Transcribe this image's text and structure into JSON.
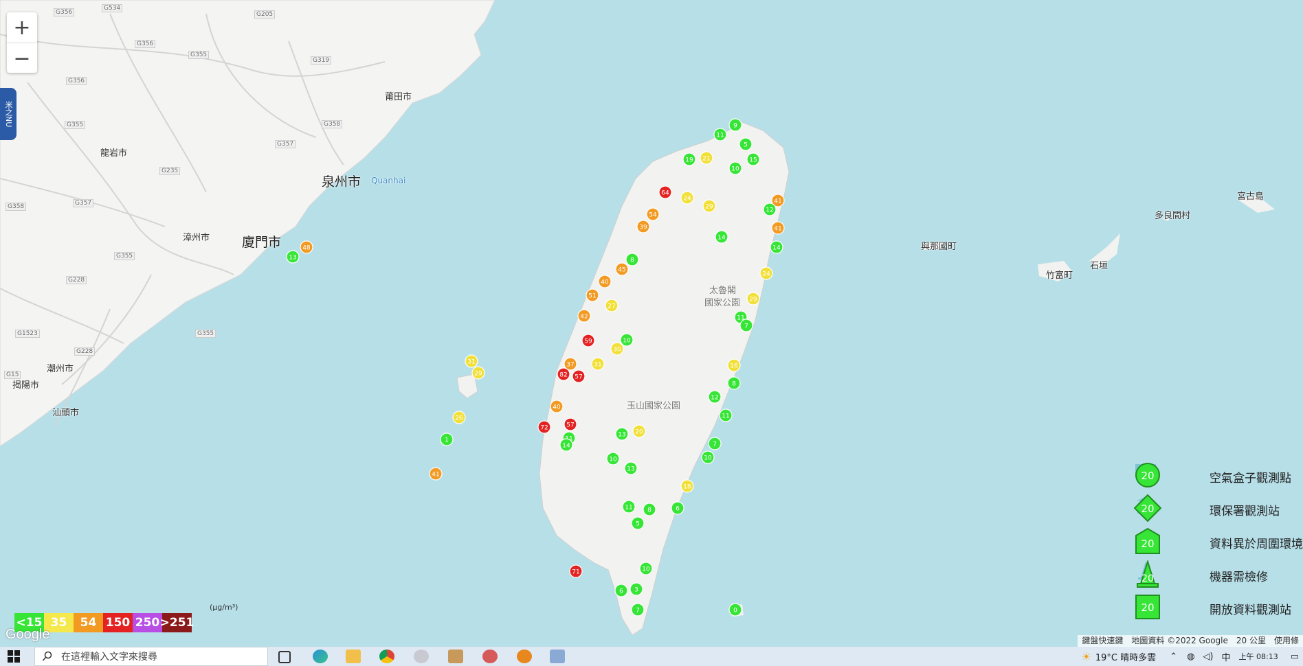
{
  "map": {
    "places": [
      {
        "name": "莆田市",
        "cls": ""
      },
      {
        "name": "龍岩市",
        "cls": ""
      },
      {
        "name": "泉州市",
        "cls": "big"
      },
      {
        "name": "漳州市",
        "cls": ""
      },
      {
        "name": "廈門市",
        "cls": "big"
      },
      {
        "name": "潮州市",
        "cls": ""
      },
      {
        "name": "揭陽市",
        "cls": ""
      },
      {
        "name": "汕頭市",
        "cls": ""
      },
      {
        "name": "Quanhai",
        "cls": "sea"
      },
      {
        "name": "與那國町",
        "cls": ""
      },
      {
        "name": "竹富町",
        "cls": ""
      },
      {
        "name": "石垣",
        "cls": ""
      },
      {
        "name": "多良間村",
        "cls": ""
      },
      {
        "name": "宮古島",
        "cls": ""
      },
      {
        "name": "太魯閣",
        "cls": "park"
      },
      {
        "name": "國家公園",
        "cls": "park"
      },
      {
        "name": "玉山國家公園",
        "cls": "park"
      }
    ],
    "roads": [
      "G356",
      "G534",
      "G205",
      "G356",
      "G355",
      "G319",
      "G356",
      "G355",
      "G358",
      "G357",
      "G235",
      "G358",
      "G357",
      "G355",
      "G228",
      "G355",
      "G1523",
      "G228",
      "G15"
    ],
    "zoom_in": "+",
    "zoom_out": "−",
    "side_tab": "米之NU"
  },
  "stations": [
    {
      "v": 9,
      "s": "box",
      "c": "#36e536"
    },
    {
      "v": 11,
      "s": "box",
      "c": "#36e536"
    },
    {
      "v": 5,
      "s": "box",
      "c": "#36e536"
    },
    {
      "v": 19,
      "s": "box",
      "c": "#36e536"
    },
    {
      "v": 21,
      "s": "box",
      "c": "#f2e03a"
    },
    {
      "v": 15,
      "s": "box",
      "c": "#36e536"
    },
    {
      "v": 10,
      "s": "box",
      "c": "#36e536"
    },
    {
      "v": 64,
      "s": "box",
      "c": "#e52222"
    },
    {
      "v": 24,
      "s": "box",
      "c": "#f2e03a"
    },
    {
      "v": 29,
      "s": "box",
      "c": "#f2e03a"
    },
    {
      "v": 41,
      "s": "box",
      "c": "#f29a22"
    },
    {
      "v": 12,
      "s": "box",
      "c": "#36e536"
    },
    {
      "v": 54,
      "s": "box",
      "c": "#f29a22"
    },
    {
      "v": 39,
      "s": "box",
      "c": "#f29a22"
    },
    {
      "v": 14,
      "s": "box",
      "c": "#36e536"
    },
    {
      "v": 8,
      "s": "box",
      "c": "#36e536"
    },
    {
      "v": 45,
      "s": "box",
      "c": "#f29a22"
    },
    {
      "v": 40,
      "s": "box",
      "c": "#f29a22"
    },
    {
      "v": 51,
      "s": "box",
      "c": "#f29a22"
    },
    {
      "v": 27,
      "s": "box",
      "c": "#f2e03a"
    },
    {
      "v": 42,
      "s": "box",
      "c": "#f29a22"
    },
    {
      "v": 59,
      "s": "box",
      "c": "#e52222"
    },
    {
      "v": 30,
      "s": "box",
      "c": "#f2e03a"
    },
    {
      "v": 10,
      "s": "box",
      "c": "#36e536"
    },
    {
      "v": 31,
      "s": "box",
      "c": "#f2e03a"
    },
    {
      "v": 37,
      "s": "box",
      "c": "#f29a22"
    },
    {
      "v": 82,
      "s": "box",
      "c": "#e52222"
    },
    {
      "v": 57,
      "s": "box",
      "c": "#e52222"
    },
    {
      "v": 40,
      "s": "box",
      "c": "#f29a22"
    },
    {
      "v": 72,
      "s": "box",
      "c": "#e52222"
    },
    {
      "v": 57,
      "s": "box",
      "c": "#e52222"
    },
    {
      "v": 11,
      "s": "box",
      "c": "#36e536"
    },
    {
      "v": 14,
      "s": "box",
      "c": "#36e536"
    },
    {
      "v": 13,
      "s": "box",
      "c": "#36e536"
    },
    {
      "v": 20,
      "s": "box",
      "c": "#f2e03a"
    },
    {
      "v": 10,
      "s": "box",
      "c": "#36e536"
    },
    {
      "v": 13,
      "s": "box",
      "c": "#36e536"
    },
    {
      "v": 11,
      "s": "box",
      "c": "#36e536"
    },
    {
      "v": 8,
      "s": "box",
      "c": "#36e536"
    },
    {
      "v": 5,
      "s": "box",
      "c": "#36e536"
    },
    {
      "v": 71,
      "s": "box",
      "c": "#e52222"
    },
    {
      "v": 10,
      "s": "box",
      "c": "#36e536"
    },
    {
      "v": 6,
      "s": "box",
      "c": "#36e536"
    },
    {
      "v": 3,
      "s": "box",
      "c": "#36e536"
    },
    {
      "v": 7,
      "s": "box",
      "c": "#36e536"
    },
    {
      "v": 0,
      "s": "box",
      "c": "#36e536"
    },
    {
      "v": 48,
      "s": "box",
      "c": "#f29a22"
    },
    {
      "v": 13,
      "s": "box",
      "c": "#36e536"
    },
    {
      "v": 31,
      "s": "box",
      "c": "#f2e03a"
    },
    {
      "v": 29,
      "s": "box",
      "c": "#f2e03a"
    },
    {
      "v": 26,
      "s": "box",
      "c": "#f2e03a"
    },
    {
      "v": 1,
      "s": "box",
      "c": "#36e536"
    },
    {
      "v": 41,
      "s": "box",
      "c": "#f29a22"
    },
    {
      "v": 11,
      "s": "box",
      "c": "#36e536"
    },
    {
      "v": 24,
      "s": "box",
      "c": "#f2e03a"
    },
    {
      "v": 14,
      "s": "box",
      "c": "#36e536"
    },
    {
      "v": 41,
      "s": "box",
      "c": "#f29a22"
    },
    {
      "v": 29,
      "s": "box",
      "c": "#f2e03a"
    },
    {
      "v": 7,
      "s": "box",
      "c": "#36e536"
    },
    {
      "v": 16,
      "s": "box",
      "c": "#f2e03a"
    },
    {
      "v": 8,
      "s": "box",
      "c": "#36e536"
    },
    {
      "v": 12,
      "s": "box",
      "c": "#36e536"
    },
    {
      "v": 11,
      "s": "box",
      "c": "#36e536"
    },
    {
      "v": 7,
      "s": "box",
      "c": "#36e536"
    },
    {
      "v": 10,
      "s": "box",
      "c": "#36e536"
    },
    {
      "v": 18,
      "s": "box",
      "c": "#f2e03a"
    },
    {
      "v": 6,
      "s": "box",
      "c": "#36e536"
    }
  ],
  "legend": {
    "items": [
      {
        "label": "空氣盒子觀測點",
        "shape": "circle",
        "value": "20"
      },
      {
        "label": "環保署觀測站",
        "shape": "diamond",
        "value": "20"
      },
      {
        "label": "資料異於周圍環境",
        "shape": "house",
        "value": "20"
      },
      {
        "label": "機器需檢修",
        "shape": "cone",
        "value": "20"
      },
      {
        "label": "開放資料觀測站",
        "shape": "square",
        "value": "20"
      }
    ]
  },
  "scale": {
    "unit": "(μg/m³)",
    "bins": [
      {
        "label": "<15",
        "color": "#36e536"
      },
      {
        "label": "35",
        "color": "#f5e84a"
      },
      {
        "label": "54",
        "color": "#f29a22"
      },
      {
        "label": "150",
        "color": "#e52222"
      },
      {
        "label": "250",
        "color": "#b94ee5"
      },
      {
        "label": ">251",
        "color": "#8c1a1a"
      }
    ]
  },
  "attribution": {
    "logo": "Google",
    "shortcuts": "鍵盤快速鍵",
    "data": "地圖資料 ©2022 Google",
    "scale": "20 公里",
    "terms": "使用條"
  },
  "taskbar": {
    "search_placeholder": "在這裡輸入文字來搜尋",
    "weather": "19°C  晴時多雲",
    "ime": "中",
    "time": "上午 08:13"
  }
}
